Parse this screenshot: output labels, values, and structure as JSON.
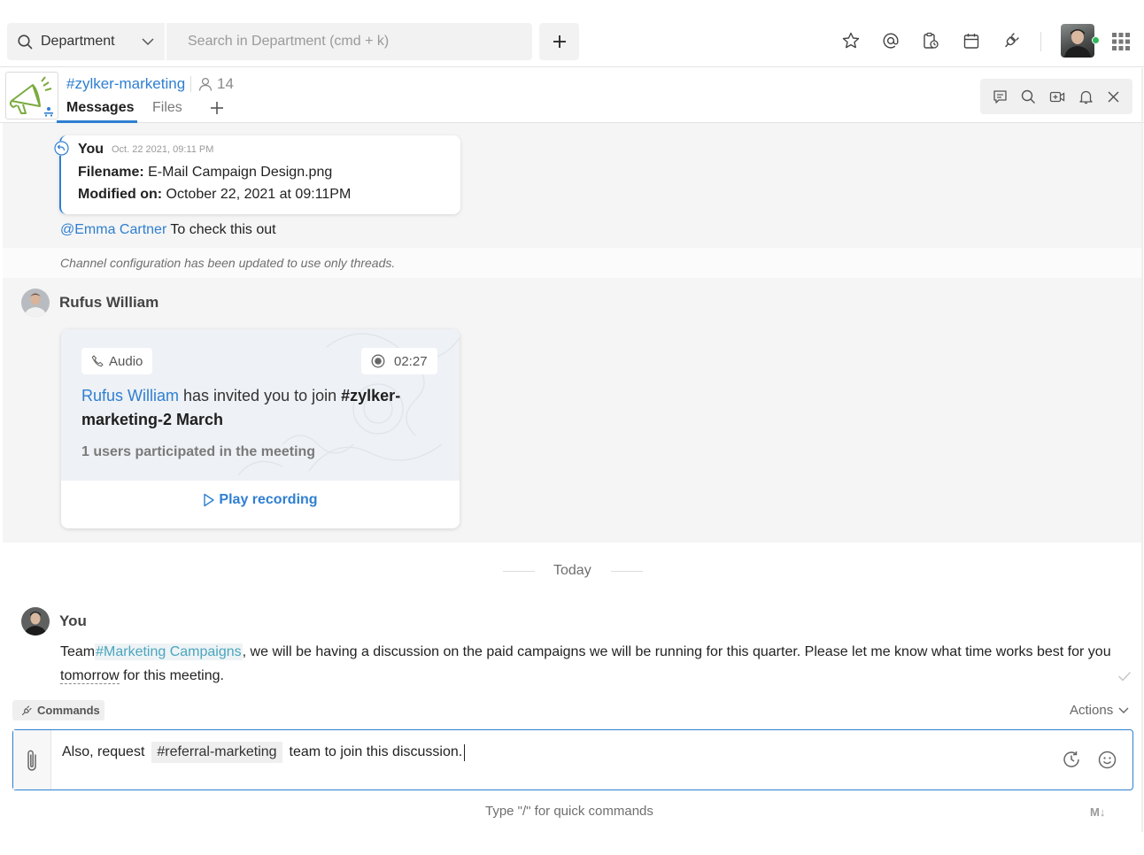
{
  "topbar": {
    "scope_label": "Department",
    "search_placeholder": "Search in Department (cmd + k)"
  },
  "channel": {
    "name": "#zylker-marketing",
    "member_count": "14",
    "tabs": [
      "Messages",
      "Files"
    ]
  },
  "reply_card": {
    "author": "You",
    "timestamp": "Oct. 22 2021, 09:11 PM",
    "filename_label": "Filename:",
    "filename_value": " E-Mail Campaign Design.png",
    "modified_label": "Modified on:",
    "modified_value": " October 22, 2021 at 09:11PM"
  },
  "mention_message": {
    "mention": "@Emma Cartner",
    "text": " To check this out"
  },
  "system_message": "Channel configuration has been updated to use only threads.",
  "call_message": {
    "sender": "Rufus William",
    "type_label": "Audio",
    "duration": "02:27",
    "inviter": "Rufus William",
    "invite_text": " has invited you to join ",
    "meeting_name": "#zylker-marketing-2 March",
    "participants": "1 users participated in the meeting",
    "play_label": "Play recording"
  },
  "divider_label": "Today",
  "latest_message": {
    "sender": "You",
    "prefix": "Team",
    "tag": "#Marketing Campaigns",
    "middle": ", we will be having a discussion on the paid campaigns we will be running for this quarter. Please let me know what time works best for you ",
    "dashed_word": "tomorrow",
    "suffix": " for this meeting."
  },
  "composer": {
    "commands_label": "Commands",
    "actions_label": "Actions",
    "text_before": "Also, request",
    "tag": "#referral-marketing",
    "text_after": "team to join this discussion.",
    "hint": "Type \"/\" for quick commands",
    "markdown_label": "M↓"
  },
  "colors": {
    "accent": "#2f7fd1",
    "online": "#2fb95c",
    "channel_tag": "#4aa5bf"
  }
}
